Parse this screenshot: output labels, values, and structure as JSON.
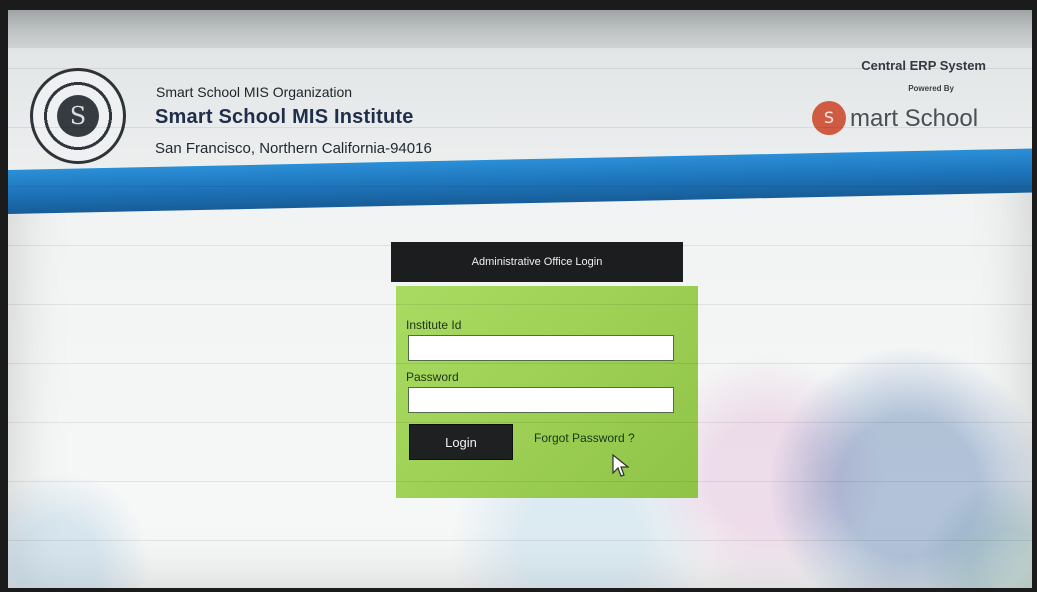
{
  "header": {
    "organization": "Smart School MIS Organization",
    "institute": "Smart School MIS Institute",
    "address": "San Francisco, Northern California-94016",
    "erp_title": "Central ERP System",
    "powered_by": "Powered By",
    "brand_text": "mart School"
  },
  "login": {
    "title": "Administrative Office Login",
    "institute_label": "Institute Id",
    "institute_value": "",
    "password_label": "Password",
    "password_value": "",
    "login_button": "Login",
    "forgot_password": "Forgot Password ?"
  },
  "colors": {
    "nav_blue": "#1f77bd",
    "login_header": "#1b1d1e",
    "login_panel": "#9ed155",
    "button": "#1e2022",
    "brand_red": "#cf5b42"
  },
  "icons": {
    "school_logo": "school-seal-icon",
    "brand_logo": "smart-school-logo-icon",
    "cursor": "mouse-pointer-icon"
  }
}
